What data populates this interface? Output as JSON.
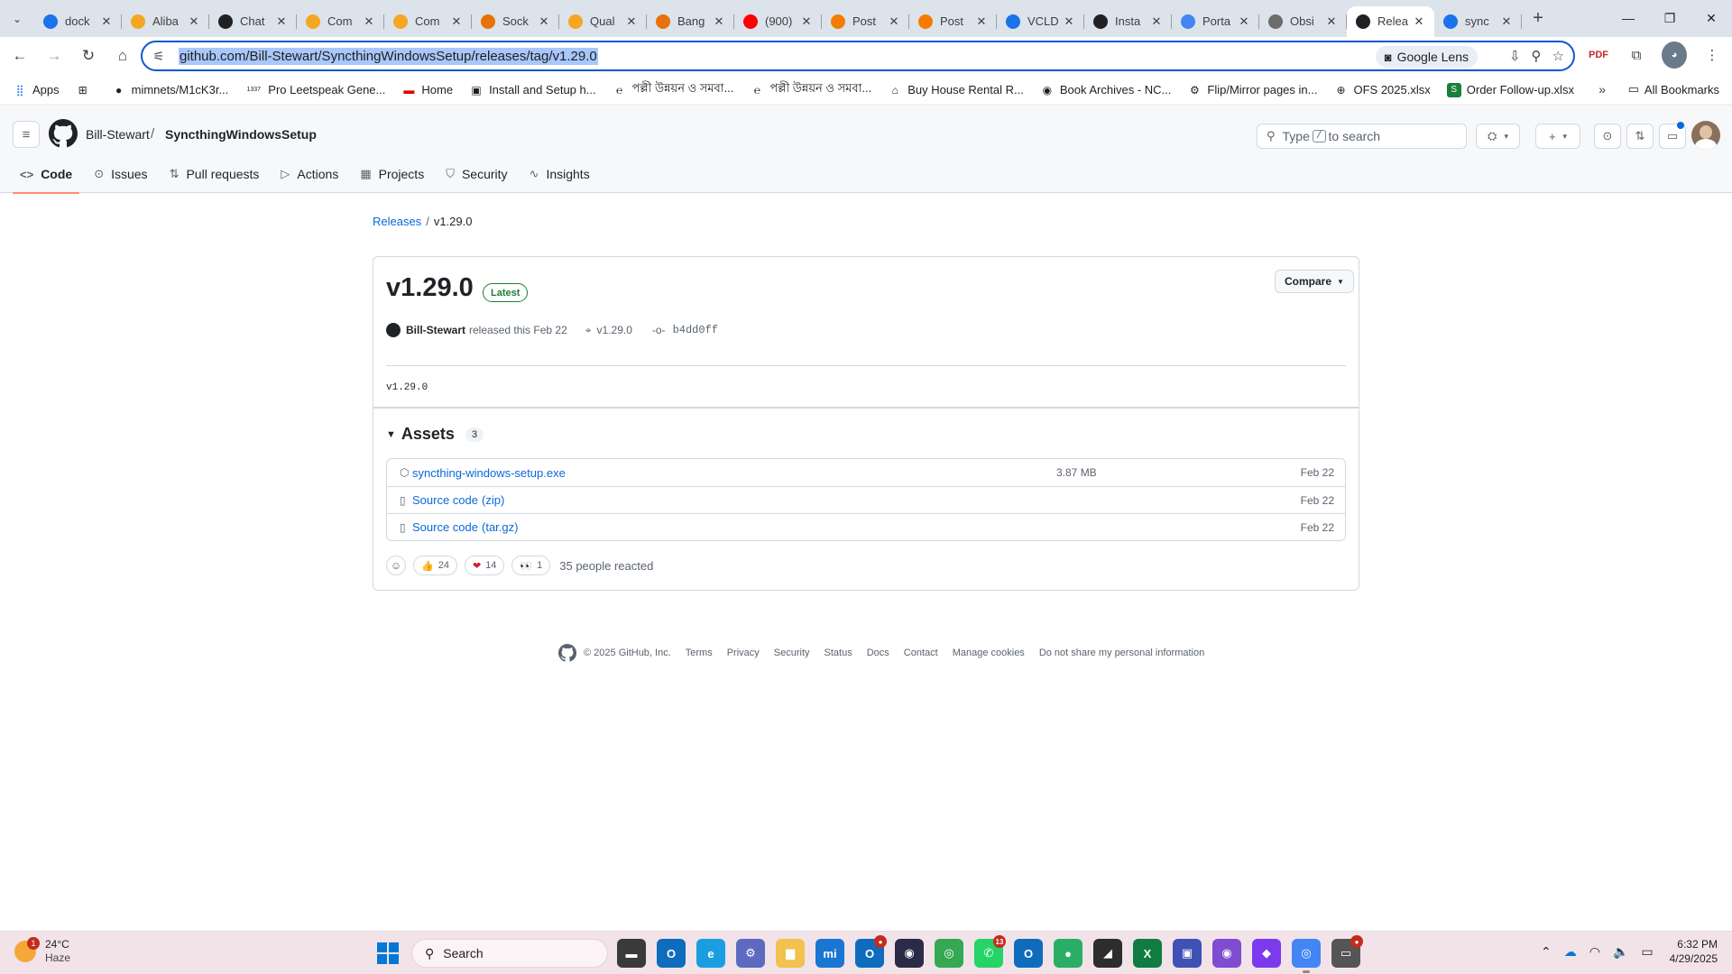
{
  "browser": {
    "tabs": [
      {
        "title": "dock",
        "icon_color": "#1a73e8",
        "icon": "chatgpt-icon"
      },
      {
        "title": "Aliba",
        "icon_color": "#f5a623",
        "icon": "copilot-icon"
      },
      {
        "title": "Chat",
        "icon_color": "#202124",
        "icon": "openai-icon"
      },
      {
        "title": "Com",
        "icon_color": "#f5a623",
        "icon": "copilot-icon"
      },
      {
        "title": "Com",
        "icon_color": "#f5a623",
        "icon": "copilot-icon"
      },
      {
        "title": "Sock",
        "icon_color": "#e8710a",
        "icon": "flag-icon"
      },
      {
        "title": "Qual",
        "icon_color": "#f5a623",
        "icon": "copilot-icon"
      },
      {
        "title": "Bang",
        "icon_color": "#e8710a",
        "icon": "flag-icon"
      },
      {
        "title": "(900)",
        "icon_color": "#ff0000",
        "icon": "youtube-icon"
      },
      {
        "title": "Post",
        "icon_color": "#f57c00",
        "icon": "blogger-icon"
      },
      {
        "title": "Post",
        "icon_color": "#f57c00",
        "icon": "blogger-icon"
      },
      {
        "title": "VCLD",
        "icon_color": "#1a73e8",
        "icon": "chatgpt-icon"
      },
      {
        "title": "Insta",
        "icon_color": "#202124",
        "icon": "github-icon"
      },
      {
        "title": "Porta",
        "icon_color": "#4285f4",
        "icon": "document-icon"
      },
      {
        "title": "Obsi",
        "icon_color": "#6c6c6c",
        "icon": "globe-icon"
      },
      {
        "title": "Relea",
        "icon_color": "#202124",
        "icon": "github-icon",
        "active": true
      },
      {
        "title": "sync",
        "icon_color": "#1a73e8",
        "icon": "chatgpt-icon"
      }
    ],
    "url": "github.com/Bill-Stewart/SyncthingWindowsSetup/releases/tag/v1.29.0",
    "lens_label": "Google Lens",
    "bookmarks": [
      {
        "label": "Apps",
        "icon": "apps-grid-icon"
      },
      {
        "label": "",
        "icon": "grid-icon"
      },
      {
        "label": "mimnets/M1cK3r...",
        "icon": "github-icon"
      },
      {
        "label": "Pro Leetspeak Gene...",
        "icon": "leet-icon"
      },
      {
        "label": "Home",
        "icon": "flag-de-icon"
      },
      {
        "label": "Install and Setup h...",
        "icon": "install-icon"
      },
      {
        "label": "পল্লী উন্নয়ন ও সমবা...",
        "icon": "edge-e-icon"
      },
      {
        "label": "পল্লী উন্নয়ন ও সমবা...",
        "icon": "edge-e-icon"
      },
      {
        "label": "Buy House Rental R...",
        "icon": "house-icon"
      },
      {
        "label": "Book Archives - NC...",
        "icon": "book-icon"
      },
      {
        "label": "Flip/Mirror pages in...",
        "icon": "gear-icon"
      },
      {
        "label": "OFS 2025.xlsx",
        "icon": "globe-icon"
      },
      {
        "label": "Order Follow-up.xlsx",
        "icon": "sheet-icon"
      }
    ],
    "all_bookmarks_label": "All Bookmarks"
  },
  "github": {
    "owner": "Bill-Stewart",
    "repo": "SyncthingWindowsSetup",
    "search_prefix": "Type",
    "search_key": "/",
    "search_suffix": "to search",
    "nav": [
      {
        "label": "Code",
        "icon": "code-icon",
        "selected": true
      },
      {
        "label": "Issues",
        "icon": "issue-icon"
      },
      {
        "label": "Pull requests",
        "icon": "pull-request-icon"
      },
      {
        "label": "Actions",
        "icon": "play-icon"
      },
      {
        "label": "Projects",
        "icon": "table-icon"
      },
      {
        "label": "Security",
        "icon": "shield-icon"
      },
      {
        "label": "Insights",
        "icon": "graph-icon"
      }
    ]
  },
  "release": {
    "breadcrumb_link": "Releases",
    "breadcrumb_current": "v1.29.0",
    "title": "v1.29.0",
    "badge": "Latest",
    "compare_label": "Compare",
    "author": "Bill-Stewart",
    "released_text": "released this Feb 22",
    "tag": "v1.29.0",
    "commit": "b4dd0ff",
    "body": "v1.29.0",
    "assets_title": "Assets",
    "assets_count": "3",
    "assets": [
      {
        "name": "syncthing-windows-setup.exe",
        "suffix": "",
        "size": "3.87 MB",
        "date": "Feb 22",
        "icon": "package-icon"
      },
      {
        "name": "Source code",
        "suffix": "(zip)",
        "size": "",
        "date": "Feb 22",
        "icon": "file-zip-icon"
      },
      {
        "name": "Source code",
        "suffix": "(tar.gz)",
        "size": "",
        "date": "Feb 22",
        "icon": "file-zip-icon"
      }
    ],
    "reactions": [
      {
        "emoji": "👍",
        "count": "24",
        "name": "thumbs-up"
      },
      {
        "emoji": "❤",
        "count": "14",
        "name": "heart"
      },
      {
        "emoji": "👀",
        "count": "1",
        "name": "eyes"
      }
    ],
    "reactions_text": "35 people reacted"
  },
  "footer": {
    "copyright": "© 2025 GitHub, Inc.",
    "links": [
      "Terms",
      "Privacy",
      "Security",
      "Status",
      "Docs",
      "Contact",
      "Manage cookies",
      "Do not share my personal information"
    ]
  },
  "taskbar": {
    "weather_temp": "24°C",
    "weather_desc": "Haze",
    "weather_badge": "1",
    "search_label": "Search",
    "apps": [
      {
        "name": "file-explorer-dark",
        "color": "#3a3a3a",
        "glyph": "▬"
      },
      {
        "name": "outlook",
        "color": "#0f6cbd",
        "glyph": "O"
      },
      {
        "name": "edge",
        "color": "#1b9de2",
        "glyph": "e"
      },
      {
        "name": "tool",
        "color": "#5c6bc0",
        "glyph": "⚙"
      },
      {
        "name": "folder",
        "color": "#f2c14e",
        "glyph": "▆"
      },
      {
        "name": "mi",
        "color": "#1976d2",
        "glyph": "mi"
      },
      {
        "name": "outlook-new",
        "color": "#0f6cbd",
        "glyph": "O",
        "badge": "●"
      },
      {
        "name": "camera",
        "color": "#2b2b48",
        "glyph": "◉"
      },
      {
        "name": "chrome",
        "color": "#34a853",
        "glyph": "◎"
      },
      {
        "name": "whatsapp",
        "color": "#25d366",
        "glyph": "✆",
        "badge": "13"
      },
      {
        "name": "outlook-classic",
        "color": "#0f6cbd",
        "glyph": "O"
      },
      {
        "name": "wechat",
        "color": "#2aae67",
        "glyph": "●"
      },
      {
        "name": "sticky",
        "color": "#2d2d2d",
        "glyph": "◢"
      },
      {
        "name": "excel",
        "color": "#107c41",
        "glyph": "X"
      },
      {
        "name": "remote",
        "color": "#3f51b5",
        "glyph": "▣"
      },
      {
        "name": "tor",
        "color": "#7e4dd2",
        "glyph": "◉"
      },
      {
        "name": "obsidian",
        "color": "#7c3aed",
        "glyph": "◆"
      },
      {
        "name": "chrome-active",
        "color": "#4285f4",
        "glyph": "◎",
        "run": true
      },
      {
        "name": "rdp",
        "color": "#555555",
        "glyph": "▭",
        "badge": "●"
      }
    ],
    "time": "6:32 PM",
    "date": "4/29/2025"
  }
}
